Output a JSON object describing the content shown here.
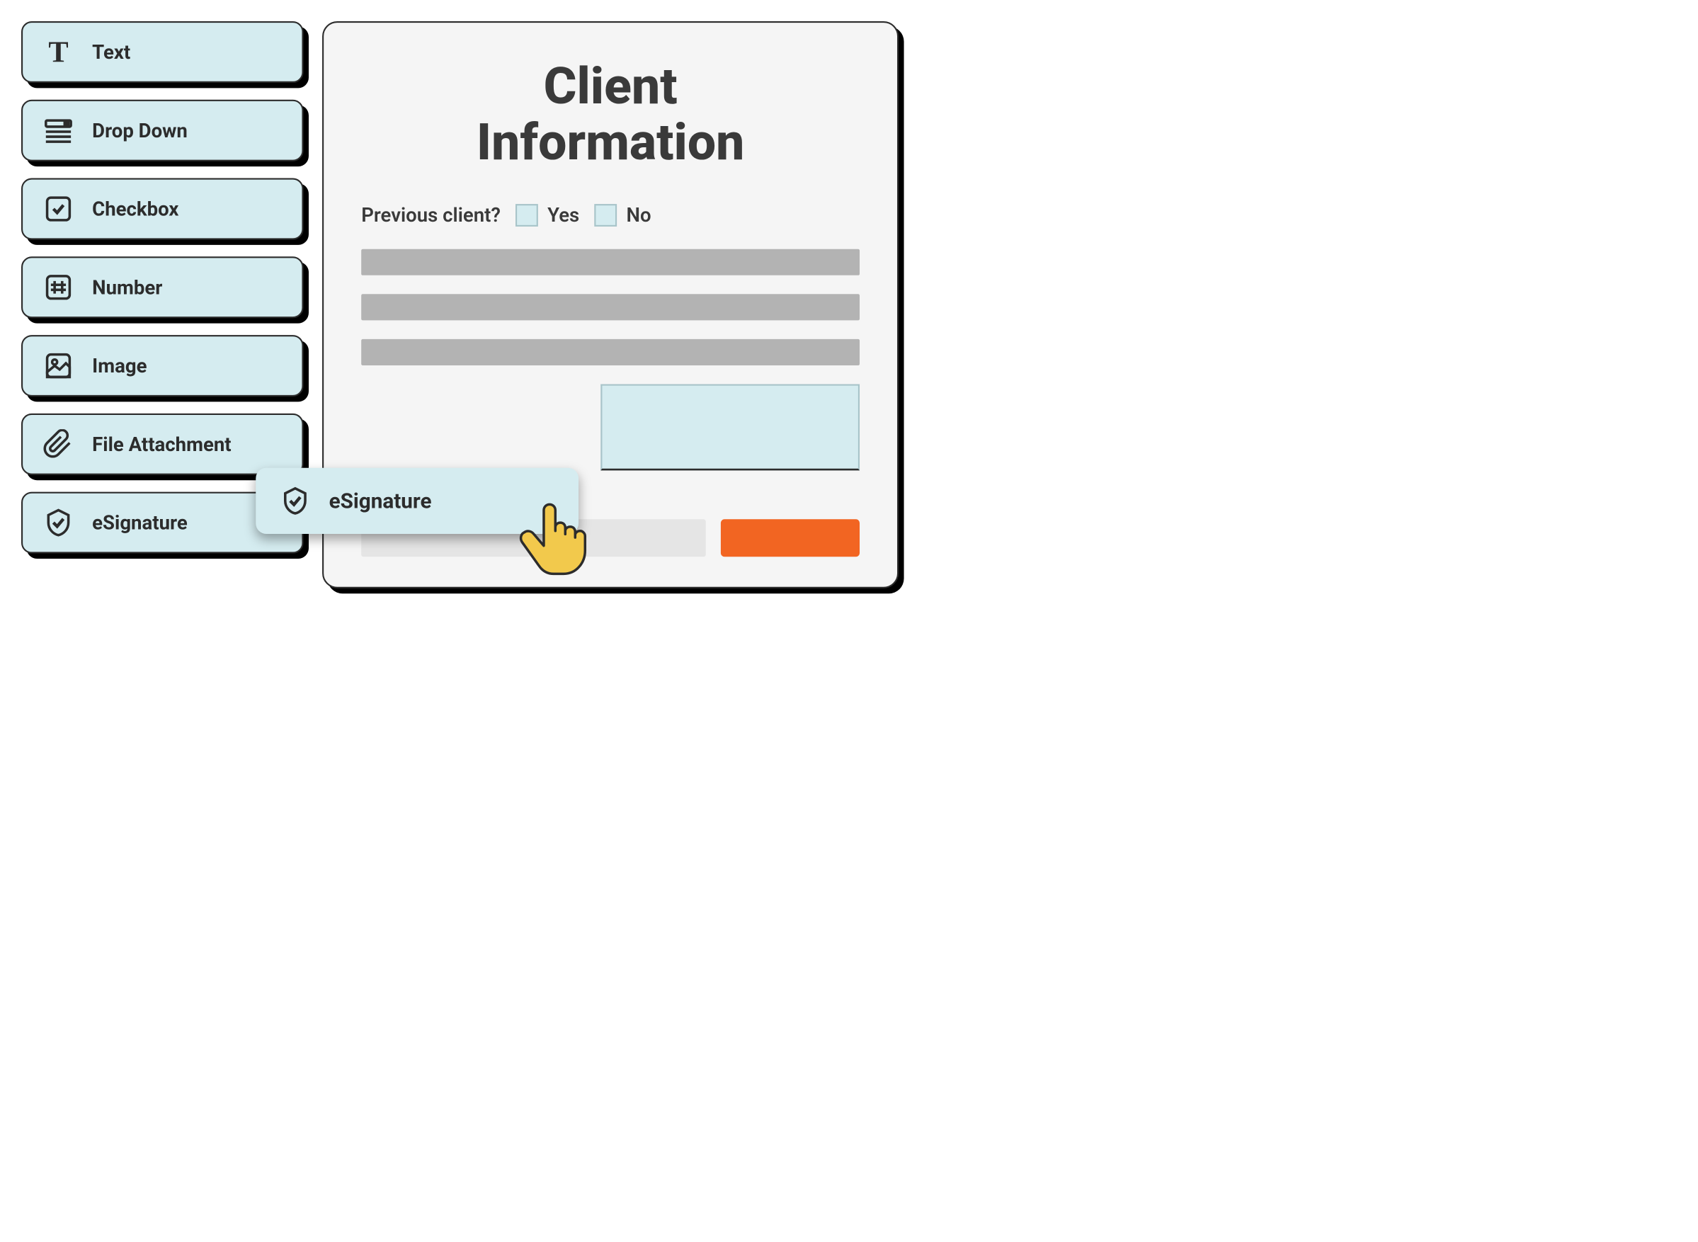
{
  "sidebar": {
    "items": [
      {
        "label": "Text",
        "icon": "text-icon"
      },
      {
        "label": "Drop Down",
        "icon": "dropdown-icon"
      },
      {
        "label": "Checkbox",
        "icon": "checkbox-icon"
      },
      {
        "label": "Number",
        "icon": "number-icon"
      },
      {
        "label": "Image",
        "icon": "image-icon"
      },
      {
        "label": "File Attachment",
        "icon": "attachment-icon"
      },
      {
        "label": "eSignature",
        "icon": "esignature-icon"
      }
    ]
  },
  "dragging": {
    "label": "eSignature",
    "icon": "esignature-icon"
  },
  "form": {
    "title_line1": "Client",
    "title_line2": "Information",
    "question": "Previous client?",
    "option_yes": "Yes",
    "option_no": "No"
  },
  "colors": {
    "block_bg": "#d5ecf0",
    "border": "#2c2c2c",
    "submit": "#f26522",
    "placeholder": "#b3b3b3"
  }
}
